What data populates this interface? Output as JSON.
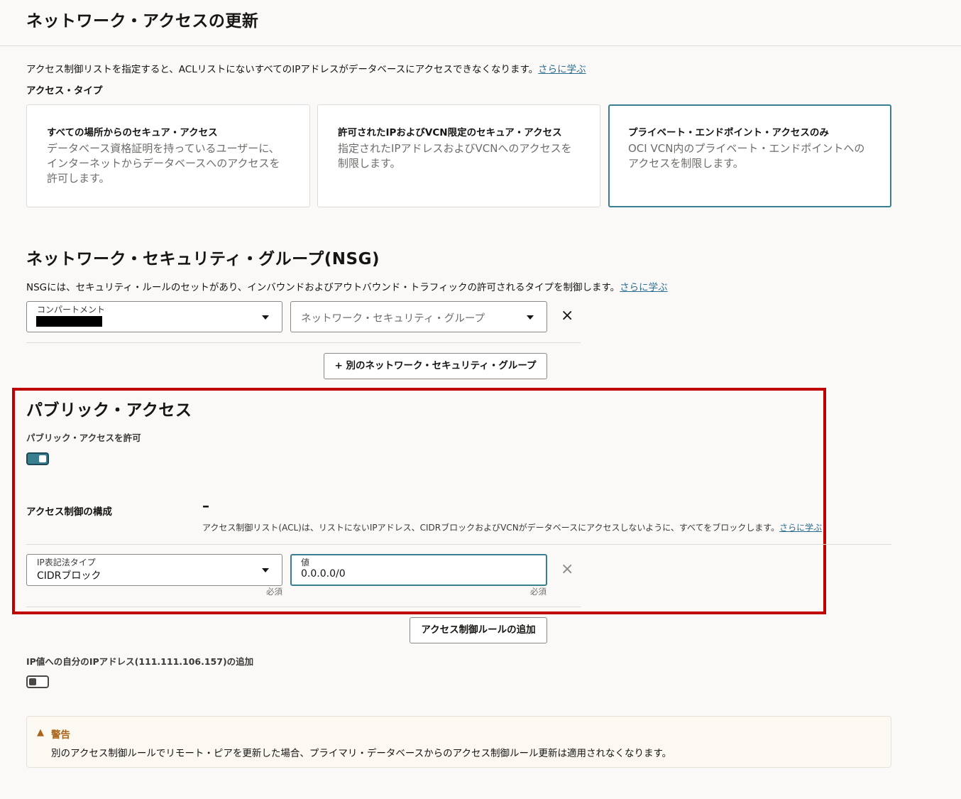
{
  "page_title": "ネットワーク・アクセスの更新",
  "acl_intro": {
    "text": "アクセス制御リストを指定すると、ACLリストにないすべてのIPアドレスがデータベースにアクセスできなくなります。",
    "link": "さらに学ぶ"
  },
  "access_type": {
    "label": "アクセス・タイプ",
    "cards": [
      {
        "title": "すべての場所からのセキュア・アクセス",
        "line1": "データベース資格証明を持っているユーザーに、",
        "line2": "インターネットからデータベースへのアクセスを",
        "line3": "許可します。"
      },
      {
        "title": "許可されたIPおよびVCN限定のセキュア・アクセス",
        "line1": "指定されたIPアドレスおよびVCNへのアクセスを",
        "line2": "制限します。",
        "line3": ""
      },
      {
        "title": "プライベート・エンドポイント・アクセスのみ",
        "line1": "OCI VCN内のプライベート・エンドポイントへの",
        "line2": "アクセスを制限します。",
        "line3": ""
      }
    ]
  },
  "nsg": {
    "heading": "ネットワーク・セキュリティ・グループ(NSG)",
    "description": "NSGには、セキュリティ・ルールのセットがあり、インバウンドおよびアウトバウンド・トラフィックの許可されるタイプを制御します。",
    "link": "さらに学ぶ",
    "compartment_label": "コンパートメント",
    "nsg_placeholder": "ネットワーク・セキュリティ・グループ",
    "remove_icon": "×",
    "add_button": "+ 別のネットワーク・セキュリティ・グループ"
  },
  "public_access": {
    "heading": "パブリック・アクセス",
    "allow_label": "パブリック・アクセスを許可",
    "config_label": "アクセス制御の構成",
    "dash": "–",
    "acl_description": "アクセス制御リスト(ACL)は、リストにないIPアドレス、CIDRブロックおよびVCNがデータベースにアクセスしないように、すべてをブロックします。",
    "link": "さらに学ぶ",
    "ip_type_label": "IP表記法タイプ",
    "ip_type_value": "CIDRブロック",
    "value_label": "値",
    "value": "0.0.0.0/0",
    "required": "必須",
    "remove_icon": "×",
    "add_rule_button": "アクセス制御ルールの追加"
  },
  "my_ip": {
    "label": "IP値への自分のIPアドレス(111.111.106.157)の追加"
  },
  "warning": {
    "title": "警告",
    "text": "別のアクセス制御ルールでリモート・ピアを更新した場合、プライマリ・データベースからのアクセス制御ルール更新は適用されなくなります。"
  },
  "colors": {
    "accent": "#3a7f90",
    "link": "#2b6d8f",
    "highlight": "#c00000",
    "warning_icon": "#a8641a"
  }
}
